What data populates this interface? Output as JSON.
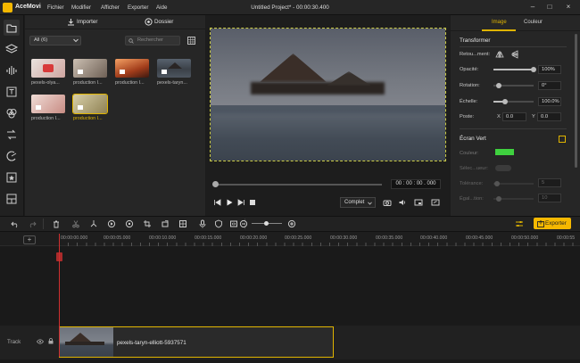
{
  "app": {
    "brand": "AceMovi",
    "title": "Untitled Project* - 00:00:30.400",
    "menus": [
      "Fichier",
      "Modifier",
      "Afficher",
      "Exporter",
      "Aide"
    ],
    "accent": "#f5b800"
  },
  "media": {
    "import_label": "Importer",
    "folder_label": "Dossier",
    "filter": "All (6)",
    "search_placeholder": "Rechercher",
    "items": [
      {
        "label": "pexels-olya..."
      },
      {
        "label": "production I..."
      },
      {
        "label": "production I..."
      },
      {
        "label": "pexels-taryn..."
      },
      {
        "label": "production I..."
      },
      {
        "label": "production I..."
      }
    ]
  },
  "preview": {
    "timecode": "00 : 00 : 00 . 000",
    "quality": "Complet"
  },
  "right": {
    "tab_image": "Image",
    "tab_color": "Couleur",
    "transform_title": "Transformer",
    "flip_label": "Retou...ment:",
    "opacity_label": "Opacité:",
    "opacity_value": "100%",
    "rotation_label": "Rotation:",
    "rotation_value": "0°",
    "scale_label": "Échelle:",
    "scale_value": "100.0%",
    "position_label": "Poste:",
    "pos_x_label": "X",
    "pos_x": "0.0",
    "pos_y_label": "Y",
    "pos_y": "0.0",
    "green_title": "Écran Vert",
    "color_label": "Couleur:",
    "select_label": "Sélec...ueur:",
    "tolerance_label": "Tolérance:",
    "tolerance_value": "5",
    "edge_label": "Égal...tion:",
    "edge_value": "10",
    "key_color": "#3fd13f"
  },
  "toolbar": {
    "export_label": "Exporter"
  },
  "timeline": {
    "ticks": [
      "00:00:00.000",
      "00:00:05.000",
      "00:00:10.000",
      "00:00:15.000",
      "00:00:20.000",
      "00:00:25.000",
      "00:00:30.000",
      "00:00:35.000",
      "00:00:40.000",
      "00:00:45.000",
      "00:00:50.000",
      "00:00:55"
    ],
    "track_label": "Track",
    "clip_name": "pexels-taryn-elliott-5937571"
  }
}
